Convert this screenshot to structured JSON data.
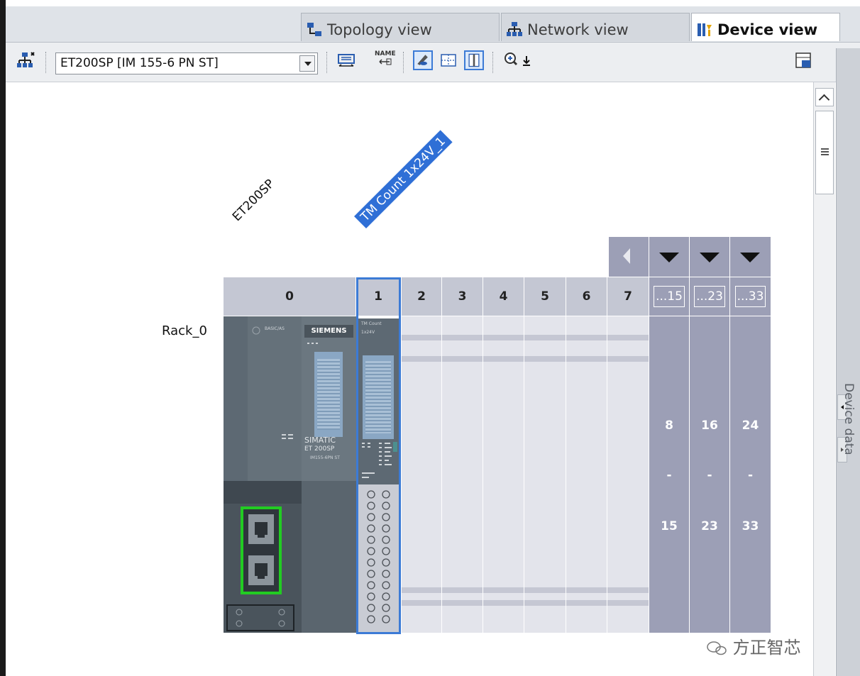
{
  "tabs": [
    {
      "label": "Topology view",
      "icon": "topology-icon",
      "active": false
    },
    {
      "label": "Network view",
      "icon": "network-icon",
      "active": false
    },
    {
      "label": "Device view",
      "icon": "device-icon",
      "active": true
    }
  ],
  "toolbar": {
    "device_select_value": "ET200SP [IM 155-6 PN ST]",
    "name_button": "NAME"
  },
  "canvas": {
    "station_label": "ET200SP",
    "selected_module_label": "TM Count 1x24V_1",
    "rack_label": "Rack_0",
    "slots": [
      "0",
      "1",
      "2",
      "3",
      "4",
      "5",
      "6",
      "7"
    ],
    "ext_slots": [
      {
        "header": "...15",
        "from": "8",
        "dash": "-",
        "to": "15"
      },
      {
        "header": "...23",
        "from": "16",
        "dash": "-",
        "to": "23"
      },
      {
        "header": "...33",
        "from": "24",
        "dash": "-",
        "to": "33"
      }
    ],
    "im_brand": "SIEMENS",
    "im_product": "SIMATIC",
    "im_series": "ET 200SP",
    "im_model": "IM155-6PN ST",
    "im_top_label": "BASIC/AS",
    "tm_top_label": "TM Count",
    "tm_sub_label": "1x24V"
  },
  "side_panel": {
    "label": "Device data"
  },
  "watermark": "方正智芯",
  "colors": {
    "selection": "#3c7bd6",
    "slot_header": "#c4c7d3",
    "ext_slot": "#9c9fb6",
    "port_highlight": "#22cc22"
  }
}
